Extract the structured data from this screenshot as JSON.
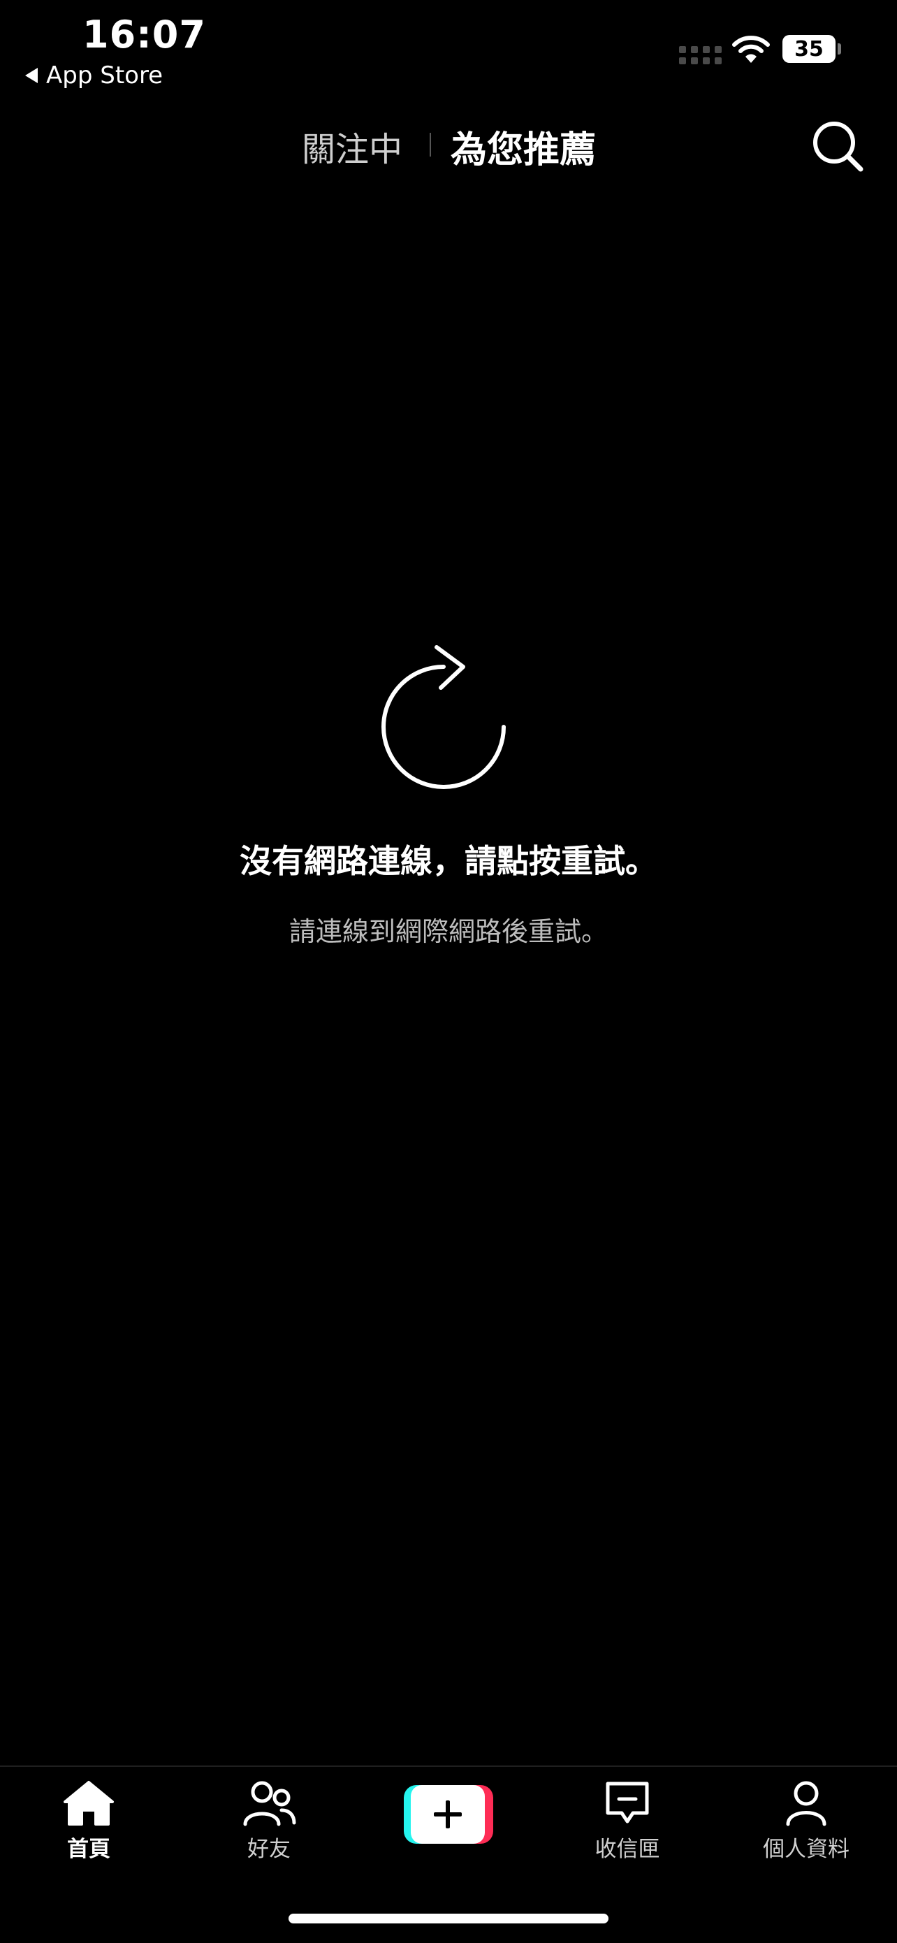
{
  "status_bar": {
    "time": "16:07",
    "back_app": "App Store",
    "battery_level": "35"
  },
  "top_tabs": {
    "following": "關注中",
    "for_you": "為您推薦",
    "active": "for_you"
  },
  "error": {
    "title": "沒有網路連線，請點按重試。",
    "subtitle": "請連線到網際網路後重試。",
    "icon": "reload-icon"
  },
  "bottom_nav": {
    "items": [
      {
        "label": "首頁",
        "icon": "home-icon",
        "active": true
      },
      {
        "label": "好友",
        "icon": "friends-icon",
        "active": false
      },
      {
        "label": "",
        "icon": "create-plus-icon",
        "active": false
      },
      {
        "label": "收信匣",
        "icon": "inbox-icon",
        "active": false
      },
      {
        "label": "個人資料",
        "icon": "profile-icon",
        "active": false
      }
    ]
  },
  "colors": {
    "background": "#000000",
    "accent_cyan": "#25f4ee",
    "accent_red": "#fe2c55"
  }
}
